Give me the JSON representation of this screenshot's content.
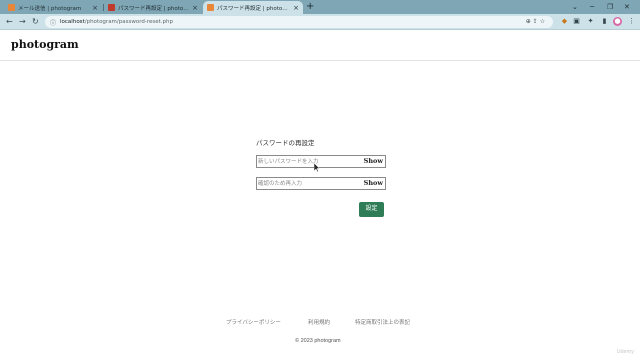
{
  "browser": {
    "tabs": [
      {
        "title": "メール送信 | photogram",
        "favicon_color": "#e8873a",
        "active": false
      },
      {
        "title": "パスワード再設定 | photogram - #...",
        "favicon_color": "#c0392b",
        "active": false
      },
      {
        "title": "パスワード再設定 | photogram",
        "favicon_color": "#e8873a",
        "active": true
      }
    ],
    "new_tab": "+",
    "url_host": "localhost",
    "url_path": "/photogram/password-reset.php"
  },
  "site": {
    "brand": "photogram"
  },
  "form": {
    "title": "パスワードの再設定",
    "new_password_placeholder": "新しいパスワードを入力",
    "confirm_password_placeholder": "確認のため再入力",
    "show_label": "Show",
    "submit_label": "設定",
    "submit_color": "#2e7d57"
  },
  "footer": {
    "links": [
      "プライバシーポリシー",
      "利用規約",
      "特定商取引法上の表記"
    ],
    "copyright": "© 2023 photogram"
  },
  "watermark": "Udemy"
}
